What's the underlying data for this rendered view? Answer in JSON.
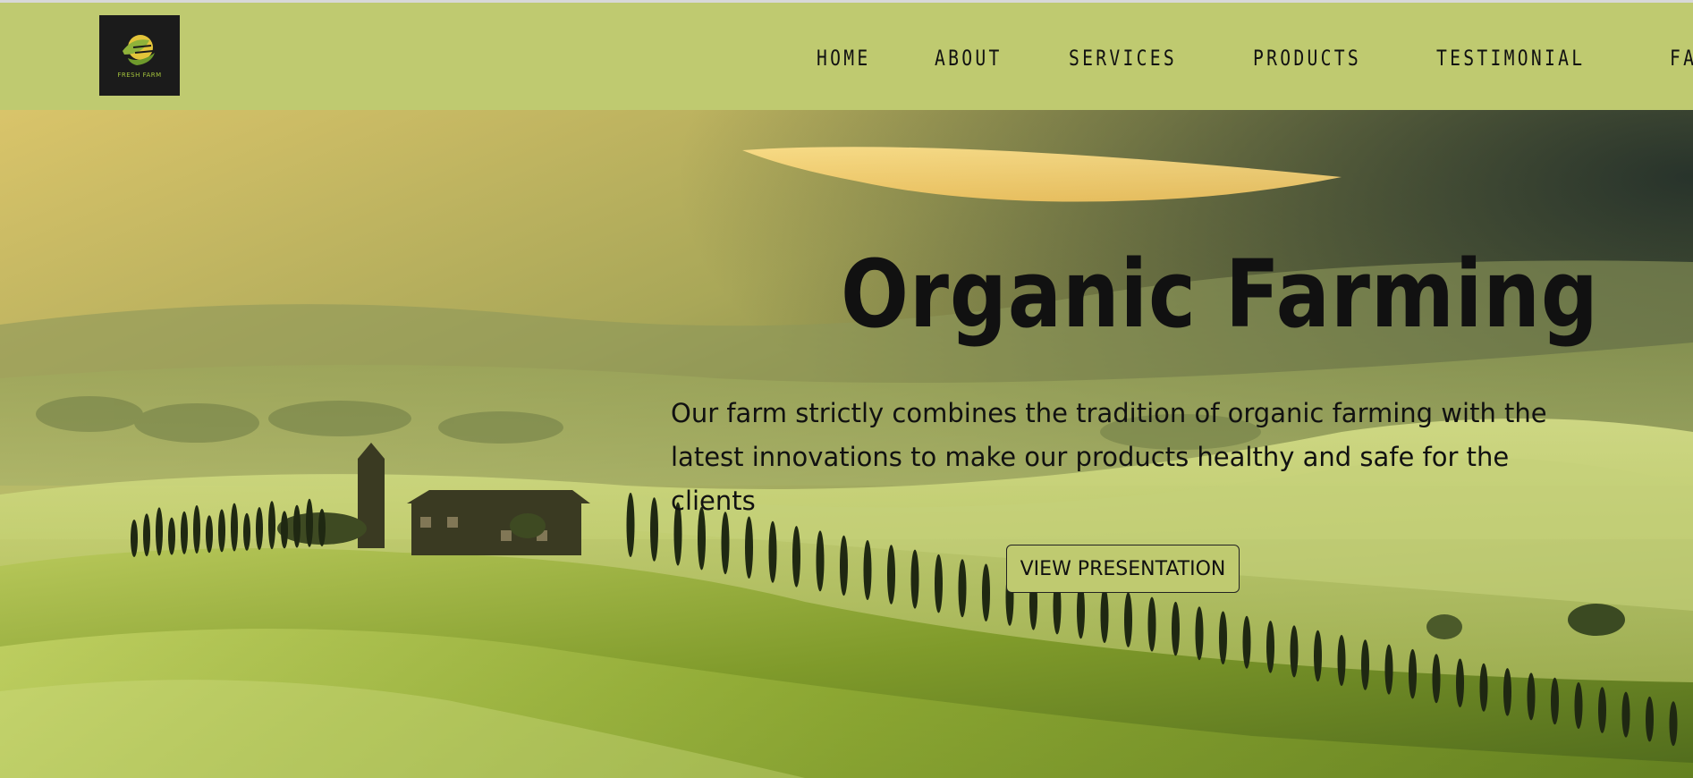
{
  "logo": {
    "text": "FRESH FARM",
    "icon": "leaf-sun-logo-icon"
  },
  "nav": {
    "items": [
      {
        "label": "HOME"
      },
      {
        "label": "ABOUT"
      },
      {
        "label": "SERVICES"
      },
      {
        "label": "PRODUCTS"
      },
      {
        "label": "TESTIMONIAL"
      },
      {
        "label": "FAQ"
      }
    ]
  },
  "hero": {
    "title": "Organic Farming",
    "description": "Our farm strictly combines the tradition of organic farming with the latest innovations to make our products healthy and safe for the clients",
    "button_label": "VIEW PRESENTATION"
  },
  "colors": {
    "header_bg": "#bfca70",
    "button_bg": "#bfca70",
    "text": "#111111"
  }
}
